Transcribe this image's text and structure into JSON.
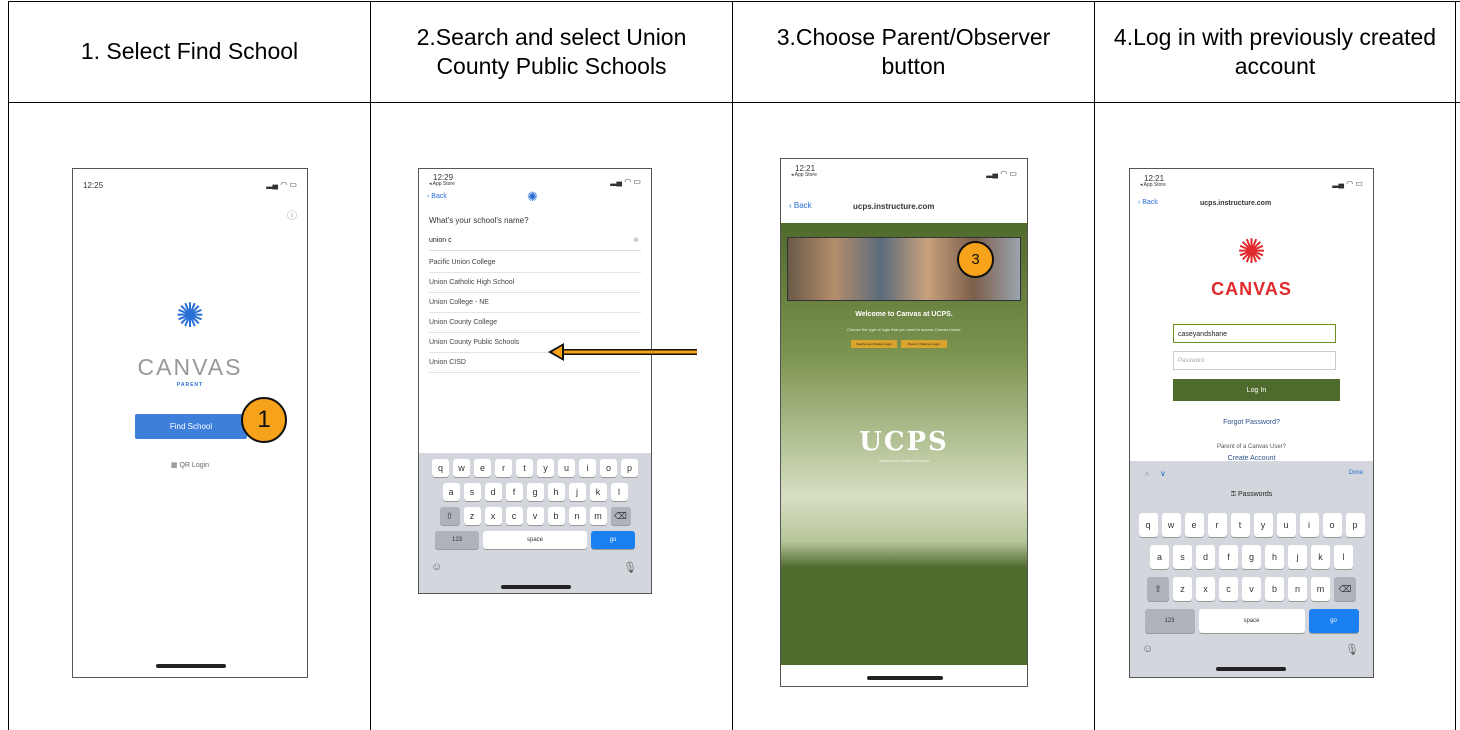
{
  "headers": [
    "1. Select Find School",
    "2.Search and select Union County Public Schools",
    "3.Choose Parent/Observer button",
    "4.Log in with previously created account"
  ],
  "colors": {
    "accent_orange": "#f7a21b",
    "canvas_red": "#e0292c",
    "ios_blue": "#1a7ff0",
    "ucps_green": "#556b2f"
  },
  "phone1": {
    "time": "12:25",
    "logo_text": "CANVAS",
    "logo_sub": "PARENT",
    "find_school_button": "Find School",
    "qr_login": "QR Login",
    "callout": "1"
  },
  "phone2": {
    "time": "12:29",
    "back_source": "◂ App Store",
    "back": "Back",
    "prompt": "What's your school's name?",
    "search_value": "union c",
    "results": [
      "Pacific Union College",
      "Union Catholic High School",
      "Union College - NE",
      "Union County College",
      "Union County Public Schools",
      "Union CISD"
    ],
    "keyboard_rows": [
      [
        "q",
        "w",
        "e",
        "r",
        "t",
        "y",
        "u",
        "i",
        "o",
        "p"
      ],
      [
        "a",
        "s",
        "d",
        "f",
        "g",
        "h",
        "j",
        "k",
        "l"
      ],
      [
        "z",
        "x",
        "c",
        "v",
        "b",
        "n",
        "m"
      ]
    ],
    "key_123": "123",
    "key_space": "space",
    "key_go": "go"
  },
  "phone3": {
    "time": "12:21",
    "back_source": "◂ App Store",
    "back": "Back",
    "url": "ucps.instructure.com",
    "welcome": "Welcome to Canvas at UCPS.",
    "instructions": "Choose the type of login that you need to access Canvas below:",
    "btn_staff": "Teacher and Student Login",
    "btn_parent": "Parent / Observer Login",
    "ucps_logo": "UCPS",
    "ucps_sub": "UNION COUNTY PUBLIC SCHOOLS",
    "callout": "3"
  },
  "phone4": {
    "time": "12:21",
    "back_source": "◂ App Store",
    "back": "Back",
    "url": "ucps.instructure.com",
    "logo_text": "CANVAS",
    "username_value": "caseyandshane",
    "password_placeholder": "Password",
    "login_button": "Log In",
    "forgot": "Forgot Password?",
    "parent_q": "Parent of a Canvas User?",
    "create_account": "Create Account",
    "done": "Done",
    "passwords_bar": "Passwords",
    "keyboard_rows": [
      [
        "q",
        "w",
        "e",
        "r",
        "t",
        "y",
        "u",
        "i",
        "o",
        "p"
      ],
      [
        "a",
        "s",
        "d",
        "f",
        "g",
        "h",
        "j",
        "k",
        "l"
      ],
      [
        "z",
        "x",
        "c",
        "v",
        "b",
        "n",
        "m"
      ]
    ],
    "key_123": "123",
    "key_space": "space",
    "key_go": "go"
  }
}
